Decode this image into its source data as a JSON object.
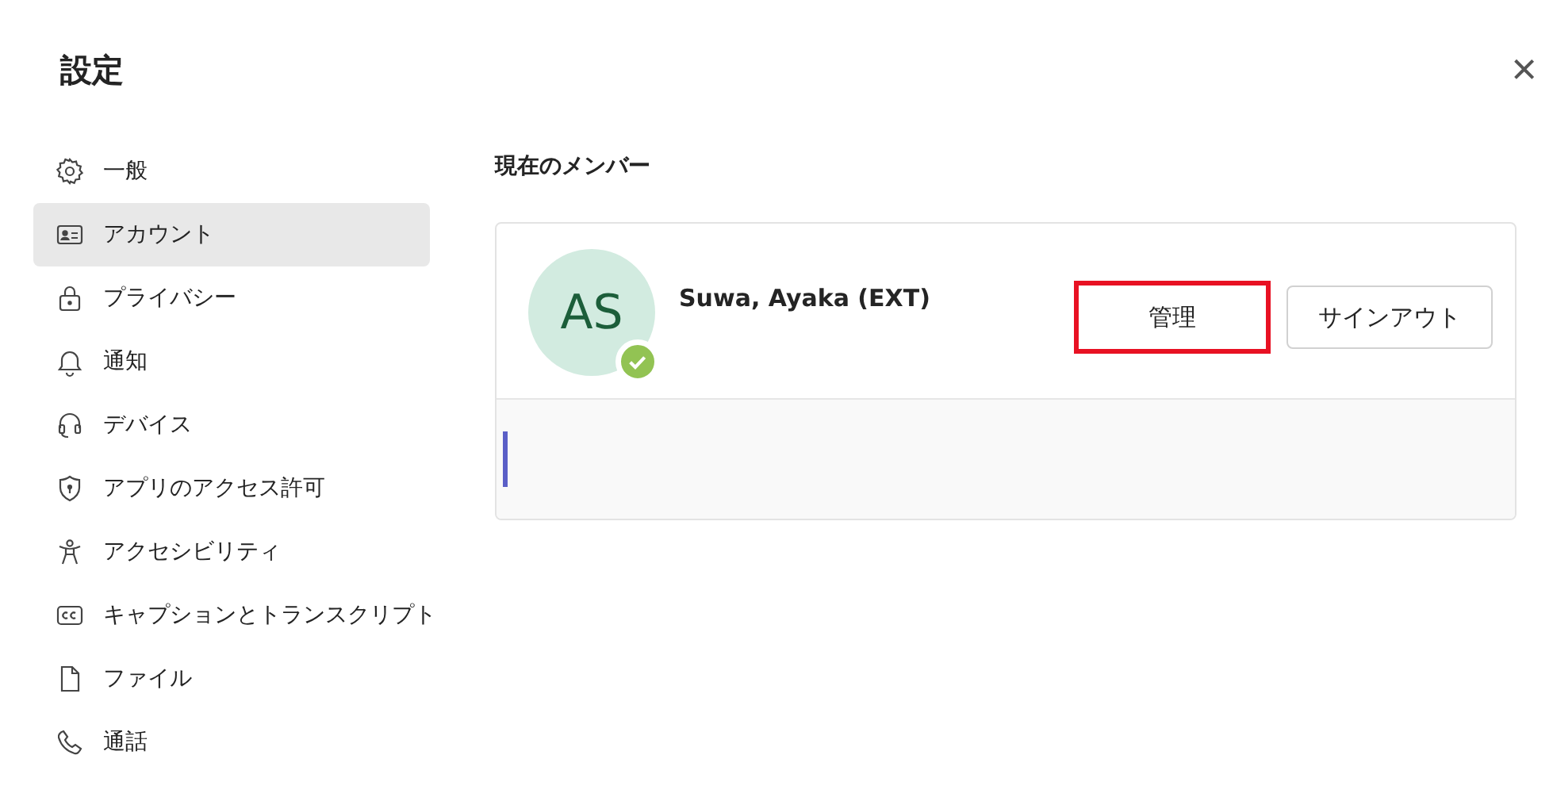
{
  "window": {
    "title": "設定",
    "close": "×"
  },
  "sidebar": {
    "items": [
      {
        "label": "一般",
        "selected": false
      },
      {
        "label": "アカウント",
        "selected": true
      },
      {
        "label": "プライバシー",
        "selected": false
      },
      {
        "label": "通知",
        "selected": false
      },
      {
        "label": "デバイス",
        "selected": false
      },
      {
        "label": "アプリのアクセス許可",
        "selected": false
      },
      {
        "label": "アクセシビリティ",
        "selected": false
      },
      {
        "label": "キャプションとトランスクリプト",
        "selected": false
      },
      {
        "label": "ファイル",
        "selected": false
      },
      {
        "label": "通話",
        "selected": false
      }
    ]
  },
  "section": {
    "heading": "現在のメンバー",
    "account": {
      "initials": "AS",
      "name": "Suwa, Ayaka (EXT)",
      "available": true,
      "buttons": [
        {
          "label": "管理",
          "highlighted": true
        },
        {
          "label": "サインアウト",
          "highlighted": false
        }
      ]
    }
  }
}
